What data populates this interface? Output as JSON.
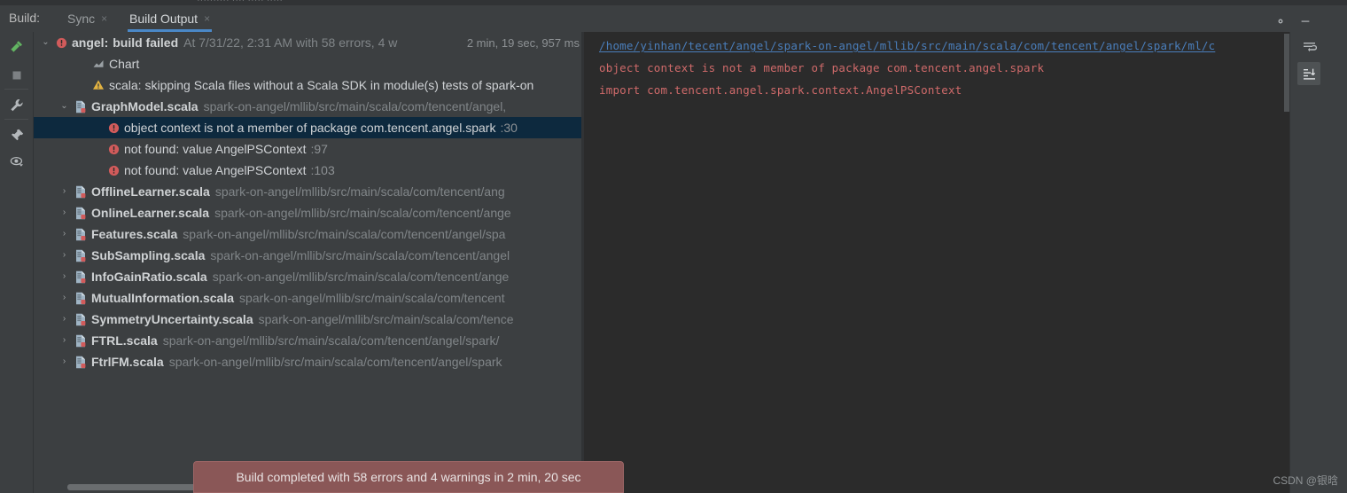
{
  "window": {
    "top_sliver_ghost": "··········   ···· ····· ·····",
    "gear_icon": "gear-icon",
    "minimize_icon": "minimize-icon"
  },
  "tabbar": {
    "label": "Build:",
    "tabs": [
      {
        "label": "Sync",
        "close": "×",
        "active": false
      },
      {
        "label": "Build Output",
        "close": "×",
        "active": true
      }
    ]
  },
  "left_rail": {
    "buttons": [
      {
        "name": "build-hammer-icon",
        "title": "Build"
      },
      {
        "name": "stop-icon",
        "title": "Stop"
      },
      {
        "name": "wrench-settings-icon",
        "title": "Settings"
      },
      {
        "name": "pin-icon",
        "title": "Pin Tab"
      },
      {
        "name": "eye-filter-icon",
        "title": "Filter"
      }
    ]
  },
  "tree": {
    "root": {
      "arrow": "⌄",
      "status_icon": "error-icon",
      "title": "angel:",
      "subtitle": "build failed",
      "details": "At 7/31/22, 2:31 AM with 58 errors, 4 w",
      "duration": "2 min, 19 sec, 957 ms"
    },
    "items": [
      {
        "kind": "chart",
        "indent": 48,
        "icon": "chart-icon",
        "title": "Chart",
        "path": "",
        "lineno": "",
        "arrow": "",
        "selected": false
      },
      {
        "kind": "warning",
        "indent": 48,
        "icon": "warning-icon",
        "title": "scala: skipping Scala files without a Scala SDK in module(s) tests of spark-on",
        "path": "",
        "lineno": "",
        "arrow": "",
        "selected": false
      },
      {
        "kind": "file",
        "indent": 28,
        "icon": "scala-file-error-icon",
        "title": "GraphModel.scala",
        "path": "spark-on-angel/mllib/src/main/scala/com/tencent/angel,",
        "lineno": "",
        "arrow": "⌄",
        "selected": false
      },
      {
        "kind": "error",
        "indent": 66,
        "icon": "error-icon",
        "title": "object context is not a member of package com.tencent.angel.spark",
        "path": "",
        "lineno": ":30",
        "arrow": "",
        "selected": true
      },
      {
        "kind": "error",
        "indent": 66,
        "icon": "error-icon",
        "title": "not found: value AngelPSContext",
        "path": "",
        "lineno": ":97",
        "arrow": "",
        "selected": false
      },
      {
        "kind": "error",
        "indent": 66,
        "icon": "error-icon",
        "title": "not found: value AngelPSContext",
        "path": "",
        "lineno": ":103",
        "arrow": "",
        "selected": false
      },
      {
        "kind": "file",
        "indent": 28,
        "icon": "scala-file-error-icon",
        "title": "OfflineLearner.scala",
        "path": "spark-on-angel/mllib/src/main/scala/com/tencent/ang",
        "lineno": "",
        "arrow": "›",
        "selected": false
      },
      {
        "kind": "file",
        "indent": 28,
        "icon": "scala-file-error-icon",
        "title": "OnlineLearner.scala",
        "path": "spark-on-angel/mllib/src/main/scala/com/tencent/ange",
        "lineno": "",
        "arrow": "›",
        "selected": false
      },
      {
        "kind": "file",
        "indent": 28,
        "icon": "scala-file-error-icon",
        "title": "Features.scala",
        "path": "spark-on-angel/mllib/src/main/scala/com/tencent/angel/spa",
        "lineno": "",
        "arrow": "›",
        "selected": false
      },
      {
        "kind": "file",
        "indent": 28,
        "icon": "scala-file-error-icon",
        "title": "SubSampling.scala",
        "path": "spark-on-angel/mllib/src/main/scala/com/tencent/angel",
        "lineno": "",
        "arrow": "›",
        "selected": false
      },
      {
        "kind": "file",
        "indent": 28,
        "icon": "scala-file-error-icon",
        "title": "InfoGainRatio.scala",
        "path": "spark-on-angel/mllib/src/main/scala/com/tencent/ange",
        "lineno": "",
        "arrow": "›",
        "selected": false
      },
      {
        "kind": "file",
        "indent": 28,
        "icon": "scala-file-error-icon",
        "title": "MutualInformation.scala",
        "path": "spark-on-angel/mllib/src/main/scala/com/tencent",
        "lineno": "",
        "arrow": "›",
        "selected": false
      },
      {
        "kind": "file",
        "indent": 28,
        "icon": "scala-file-error-icon",
        "title": "SymmetryUncertainty.scala",
        "path": "spark-on-angel/mllib/src/main/scala/com/tence",
        "lineno": "",
        "arrow": "›",
        "selected": false
      },
      {
        "kind": "file",
        "indent": 28,
        "icon": "scala-file-error-icon",
        "title": "FTRL.scala",
        "path": "spark-on-angel/mllib/src/main/scala/com/tencent/angel/spark/",
        "lineno": "",
        "arrow": "›",
        "selected": false
      },
      {
        "kind": "file",
        "indent": 28,
        "icon": "scala-file-error-icon",
        "title": "FtrlFM.scala",
        "path": "spark-on-angel/mllib/src/main/scala/com/tencent/angel/spark",
        "lineno": "",
        "arrow": "›",
        "selected": false
      }
    ]
  },
  "console": {
    "lines": [
      {
        "type": "link",
        "text": "/home/yinhan/tecent/angel/spark-on-angel/mllib/src/main/scala/com/tencent/angel/spark/ml/c"
      },
      {
        "type": "error",
        "text": "object context is not a member of package com.tencent.angel.spark"
      },
      {
        "type": "error",
        "text": "import com.tencent.angel.spark.context.AngelPSContext"
      }
    ],
    "rail_buttons": [
      {
        "name": "soft-wrap-icon",
        "title": "Soft-Wrap"
      },
      {
        "name": "scroll-to-end-icon",
        "title": "Scroll to End"
      }
    ]
  },
  "toast": {
    "text": "Build completed with 58 errors and 4 warnings in 2 min, 20 sec"
  },
  "watermark": {
    "text": "CSDN @银晗"
  },
  "colors": {
    "panel_bg": "#3c3f41",
    "console_bg": "#2b2b2b",
    "selection": "#0d293e",
    "tab_underline": "#4a88c7",
    "error_red": "#cf6a6a",
    "link_blue": "#4a7ebb",
    "warning_yellow": "#e3b341",
    "toast_bg": "#8a5757"
  }
}
